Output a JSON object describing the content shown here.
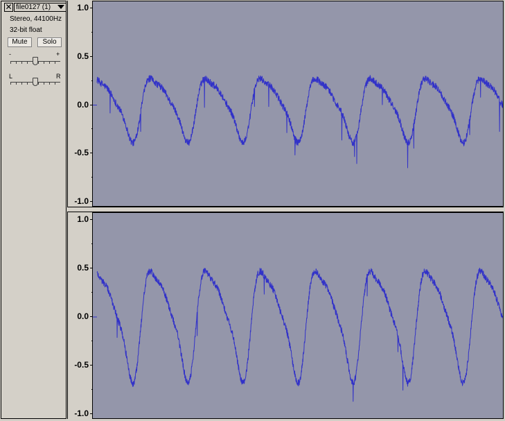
{
  "track": {
    "close_glyph": "✕",
    "name": "file0127 (1)",
    "format": "Stereo, 44100Hz",
    "sample_format": "32-bit float",
    "mute_label": "Mute",
    "solo_label": "Solo",
    "gain_minus": "-",
    "gain_plus": "+",
    "pan_left": "L",
    "pan_right": "R",
    "gain_level": 0.5,
    "pan_position": 0.5
  },
  "rulers": {
    "labels": [
      "1.0",
      "0.5",
      "0.0",
      "-0.5",
      "-1.0"
    ]
  },
  "colors": {
    "waveform": "#3232c8",
    "background": "#9496aa"
  },
  "waveform": {
    "cycles": 7.4,
    "phase": 0.16,
    "left_channel": {
      "peak": 0.36,
      "trough": -0.36
    },
    "right_channel": {
      "peak": 0.62,
      "trough": -0.63
    }
  }
}
